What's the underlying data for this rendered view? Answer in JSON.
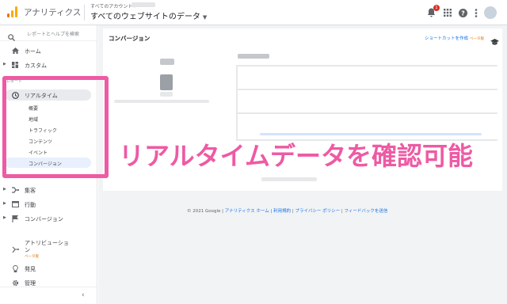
{
  "header": {
    "app_name": "アナリティクス",
    "breadcrumb": "すべてのアカウント ›",
    "property": "すべてのウェブサイトのデータ",
    "notification_count": "1"
  },
  "sidebar": {
    "search_placeholder": "レポートとヘルプを検索",
    "section_label": "レポート",
    "items": [
      {
        "label": "ホーム"
      },
      {
        "label": "カスタム"
      },
      {
        "label": "リアルタイム"
      },
      {
        "label": "集客"
      },
      {
        "label": "行動"
      },
      {
        "label": "コンバージョン"
      },
      {
        "label": "アトリビューション"
      },
      {
        "label": "発見"
      },
      {
        "label": "管理"
      }
    ],
    "realtime_sub": [
      "概要",
      "地域",
      "トラフィック",
      "コンテンツ",
      "イベント",
      "コンバージョン"
    ],
    "attribution_line1": "アトリビューショ",
    "attribution_line2": "ン",
    "beta_label": "ベータ版"
  },
  "main": {
    "title": "コンバージョン",
    "shortcut_label": "ショートカットを作成",
    "shortcut_beta": "ベータ版",
    "big_value": "0"
  },
  "footer": {
    "copyright": "© 2021 Google |",
    "links": [
      "アナリティクス ホーム",
      "利用規約",
      "プライバシー ポリシー",
      "フィードバックを送信"
    ]
  },
  "annotation": {
    "text": "リアルタイムデータを確認可能"
  },
  "colors": {
    "accent_pink": "#ee5aa4",
    "link_blue": "#1a73e8",
    "logo_orange": "#f9ab00",
    "logo_dark_orange": "#e37400"
  }
}
